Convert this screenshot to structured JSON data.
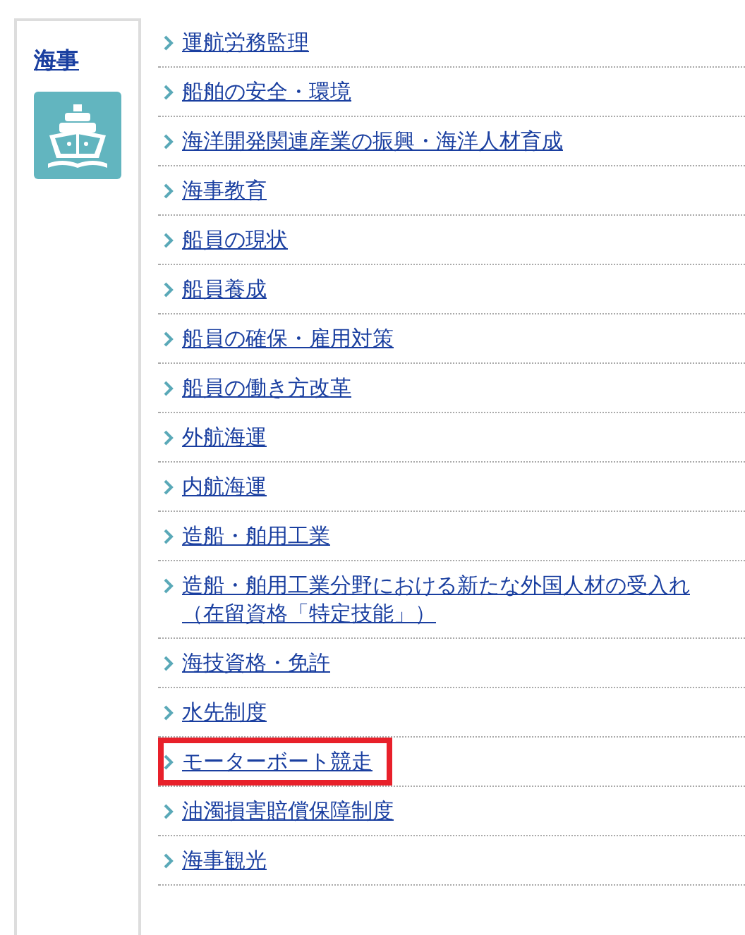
{
  "category": {
    "title": "海事"
  },
  "links": [
    {
      "label": "運航労務監理",
      "highlighted": false
    },
    {
      "label": "船舶の安全・環境",
      "highlighted": false
    },
    {
      "label": "海洋開発関連産業の振興・海洋人材育成",
      "highlighted": false
    },
    {
      "label": "海事教育",
      "highlighted": false
    },
    {
      "label": "船員の現状",
      "highlighted": false
    },
    {
      "label": "船員養成",
      "highlighted": false
    },
    {
      "label": "船員の確保・雇用対策",
      "highlighted": false
    },
    {
      "label": "船員の働き方改革",
      "highlighted": false
    },
    {
      "label": "外航海運",
      "highlighted": false
    },
    {
      "label": "内航海運",
      "highlighted": false
    },
    {
      "label": "造船・舶用工業",
      "highlighted": false
    },
    {
      "label": "造船・舶用工業分野における新たな外国人材の受入れ（在留資格「特定技能」）",
      "highlighted": false
    },
    {
      "label": "海技資格・免許",
      "highlighted": false
    },
    {
      "label": "水先制度",
      "highlighted": false
    },
    {
      "label": "モーターボート競走",
      "highlighted": true
    },
    {
      "label": "油濁損害賠償保障制度",
      "highlighted": false
    },
    {
      "label": "海事観光",
      "highlighted": false
    }
  ]
}
